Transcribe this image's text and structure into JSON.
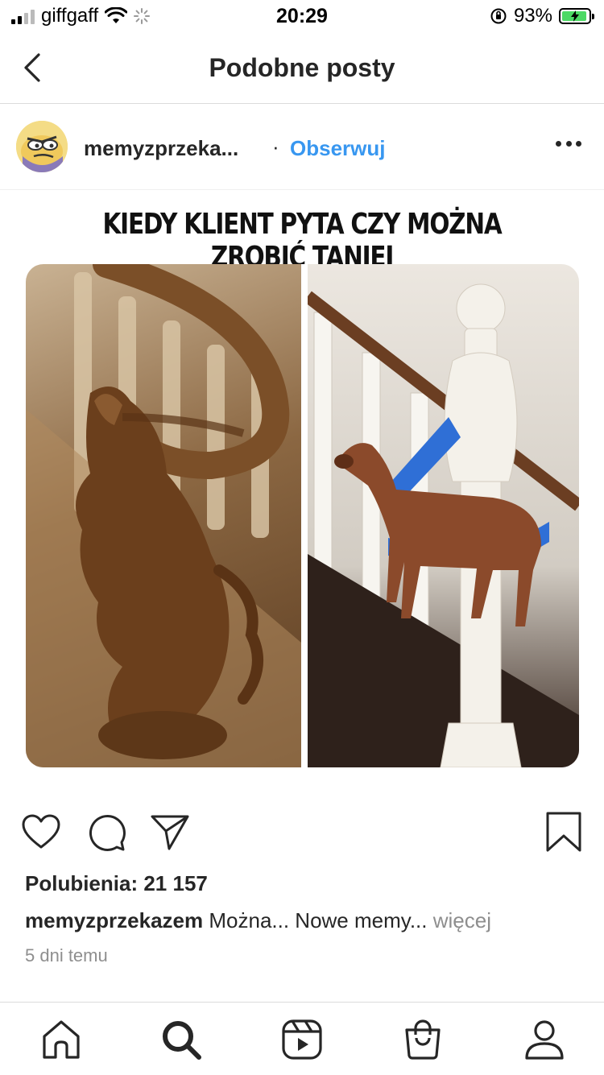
{
  "status_bar": {
    "carrier": "giffgaff",
    "time": "20:29",
    "battery_percent": "93%",
    "battery_level": 0.93
  },
  "nav": {
    "title": "Podobne posty"
  },
  "post": {
    "username_short": "memyzprzeka...",
    "separator": "·",
    "follow_label": "Obserwuj",
    "meme_text": "KIEDY KLIENT PYTA CZY MOŻNA ZROBIĆ TANIEJ",
    "likes": "Polubienia: 21 157",
    "caption_user": "memyzprzekazem",
    "caption_text": "Można... Nowe memy...",
    "caption_more": "więcej",
    "time_ago": "5 dni temu"
  },
  "icons": {
    "back": "chevron-left-icon",
    "more": "more-horizontal-icon",
    "like": "heart-icon",
    "comment": "comment-icon",
    "share": "paper-plane-icon",
    "save": "bookmark-icon",
    "tabs": [
      "home-icon",
      "search-icon",
      "reels-icon",
      "shop-icon",
      "profile-icon"
    ]
  },
  "colors": {
    "accent": "#3897f0",
    "text": "#262626",
    "muted": "#8e8e8e",
    "battery": "#4cd964"
  }
}
